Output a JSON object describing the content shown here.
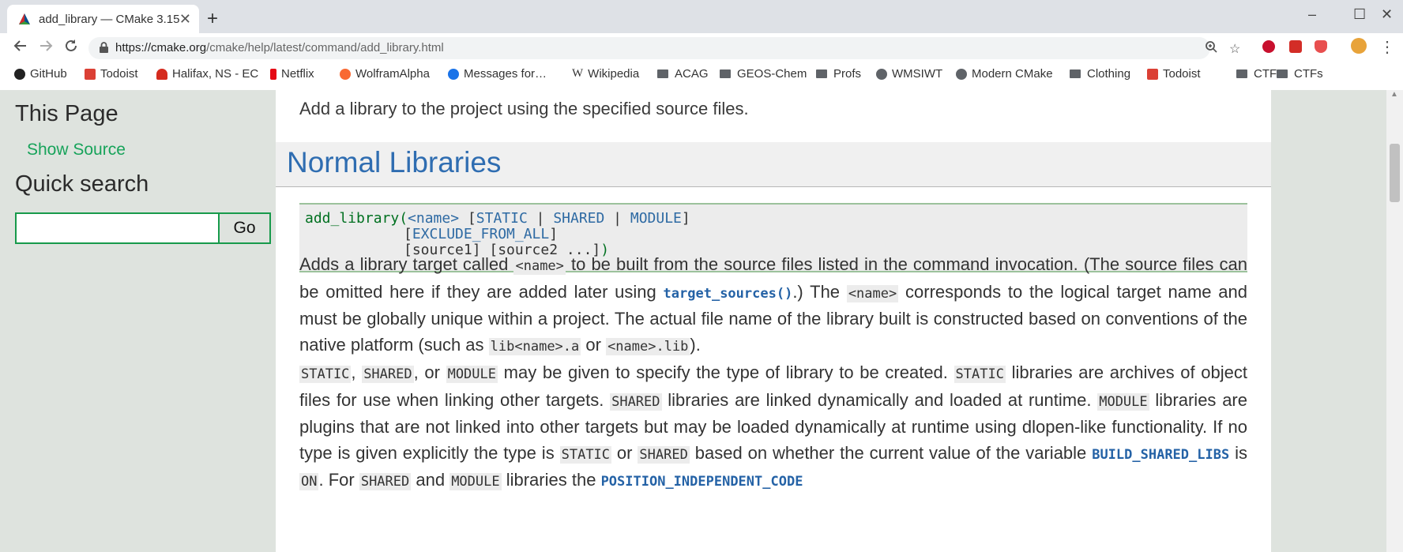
{
  "browser": {
    "tab_title": "add_library — CMake 3.15",
    "tab_close": "✕",
    "new_tab": "+",
    "window_controls": [
      "–",
      "☐",
      "✕"
    ],
    "url_host": "https://cmake.org",
    "url_path": "/cmake/help/latest/command/add_library.html",
    "nav_icons": [
      "back-icon",
      "forward-icon",
      "reload-icon"
    ],
    "extensions": [
      {
        "name": "adblock-plus-icon",
        "color": "#c8102e"
      },
      {
        "name": "lastpass-icon",
        "color": "#d32d27"
      },
      {
        "name": "ublock-icon",
        "color": "#e84f4f"
      }
    ]
  },
  "bookmarks": [
    {
      "label": "GitHub",
      "icon": "github-icon",
      "color": "#222222"
    },
    {
      "label": "Todoist",
      "icon": "todoist-icon",
      "color": "#db4035"
    },
    {
      "label": "Halifax, NS - EC",
      "icon": "maple-leaf-icon",
      "color": "#d52b1e"
    },
    {
      "label": "Netflix",
      "icon": "netflix-icon",
      "color": "#e50914"
    },
    {
      "label": "WolframAlpha",
      "icon": "wolframalpha-icon",
      "color": "#f96932"
    },
    {
      "label": "Messages for…",
      "icon": "messages-icon",
      "color": "#1a73e8"
    },
    {
      "label": "Wikipedia",
      "icon": "wikipedia-icon",
      "color": "#333333"
    },
    {
      "label": "ACAG",
      "icon": "folder-icon",
      "color": "#5f6368"
    },
    {
      "label": "GEOS-Chem",
      "icon": "folder-icon",
      "color": "#5f6368"
    },
    {
      "label": "Profs",
      "icon": "folder-icon",
      "color": "#5f6368"
    },
    {
      "label": "WMSIWT",
      "icon": "globe-icon",
      "color": "#5f6368"
    },
    {
      "label": "Modern CMake",
      "icon": "globe-icon",
      "color": "#5f6368"
    },
    {
      "label": "Clothing",
      "icon": "folder-icon",
      "color": "#5f6368"
    },
    {
      "label": "Todoist",
      "icon": "todoist-icon",
      "color": "#db4035"
    },
    {
      "label": "CTFs",
      "icon": "folder-icon",
      "color": "#5f6368"
    },
    {
      "label": "CTFs",
      "icon": "folder-icon",
      "color": "#5f6368"
    }
  ],
  "sidebar": {
    "this_page": "This Page",
    "show_source": "Show Source",
    "quick_search": "Quick search",
    "search_value": "",
    "go": "Go"
  },
  "content": {
    "intro": "Add a library to the project using the specified source files.",
    "section_title": "Normal Libraries",
    "code": {
      "fn": "add_library(",
      "name": "<name>",
      "open": " [",
      "static": "STATIC",
      "sep1": " | ",
      "shared": "SHARED",
      "sep2": " | ",
      "module": "MODULE",
      "close": "]",
      "open2": "[",
      "exclude": "EXCLUDE_FROM_ALL",
      "close2": "]",
      "sources": "[source1] [source2 ...]",
      "paren": ")"
    },
    "p1": {
      "t1": "Adds a library target called ",
      "c1": "<name>",
      "t2": " to be built from the source files listed in the command invocation. (The source files can be omitted here if they are added later using ",
      "l1": "target_sources()",
      "t3": ".) The ",
      "c2": "<name>",
      "t4": " corresponds to the logical target name and must be globally unique within a project. The actual file name of the library built is constructed based on conventions of the native platform (such as ",
      "c3": "lib<name>.a",
      "t5": " or ",
      "c4": "<name>.lib",
      "t6": ")."
    },
    "p2": {
      "c1": "STATIC",
      "t1": ", ",
      "c2": "SHARED",
      "t2": ", or ",
      "c3": "MODULE",
      "t3": " may be given to specify the type of library to be created. ",
      "c4": "STATIC",
      "t4": " libraries are archives of object files for use when linking other targets. ",
      "c5": "SHARED",
      "t5": " libraries are linked dynamically and loaded at runtime. ",
      "c6": "MODULE",
      "t6": " libraries are plugins that are not linked into other targets but may be loaded dynamically at runtime using dlopen-like functionality. If no type is given explicitly the type is ",
      "c7": "STATIC",
      "t7": " or ",
      "c8": "SHARED",
      "t8": " based on whether the current value of the variable ",
      "l1": "BUILD_SHARED_LIBS",
      "t9": " is ",
      "c9": "ON",
      "t10": ". For ",
      "c10": "SHARED",
      "t11": " and ",
      "c11": "MODULE",
      "t12": " libraries the ",
      "l2": "POSITION_INDEPENDENT_CODE"
    }
  }
}
